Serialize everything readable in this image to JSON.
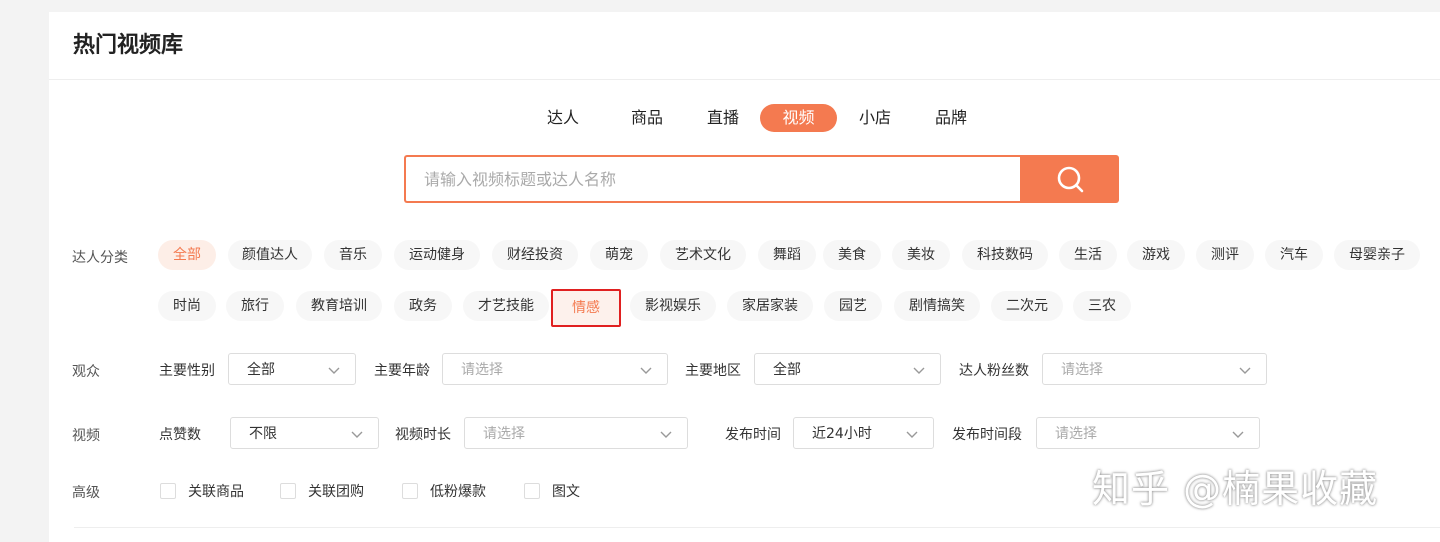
{
  "header": {
    "title": "热门视频库"
  },
  "tabs": [
    {
      "label": "达人",
      "active": false
    },
    {
      "label": "商品",
      "active": false
    },
    {
      "label": "直播",
      "active": false
    },
    {
      "label": "视频",
      "active": true
    },
    {
      "label": "小店",
      "active": false
    },
    {
      "label": "品牌",
      "active": false
    }
  ],
  "search": {
    "placeholder": "请输入视频标题或达人名称",
    "icon": "search-icon"
  },
  "category": {
    "label": "达人分类",
    "row1": [
      "全部",
      "颜值达人",
      "音乐",
      "运动健身",
      "财经投资",
      "萌宠",
      "艺术文化",
      "舞蹈",
      "美食",
      "美妆",
      "科技数码",
      "生活",
      "游戏",
      "测评",
      "汽车",
      "母婴亲子"
    ],
    "row2": [
      "时尚",
      "旅行",
      "教育培训",
      "政务",
      "才艺技能",
      "情感",
      "影视娱乐",
      "家居家装",
      "园艺",
      "剧情搞笑",
      "二次元",
      "三农"
    ],
    "active": "全部",
    "highlighted": "情感"
  },
  "audience": {
    "label": "观众",
    "filters": [
      {
        "label": "主要性别",
        "value": "全部",
        "placeholder": false
      },
      {
        "label": "主要年龄",
        "value": "请选择",
        "placeholder": true
      },
      {
        "label": "主要地区",
        "value": "全部",
        "placeholder": false
      },
      {
        "label": "达人粉丝数",
        "value": "请选择",
        "placeholder": true
      }
    ]
  },
  "video": {
    "label": "视频",
    "filters": [
      {
        "label": "点赞数",
        "value": "不限",
        "placeholder": false
      },
      {
        "label": "视频时长",
        "value": "请选择",
        "placeholder": true
      },
      {
        "label": "发布时间",
        "value": "近24小时",
        "placeholder": false
      },
      {
        "label": "发布时间段",
        "value": "请选择",
        "placeholder": true
      }
    ]
  },
  "advanced": {
    "label": "高级",
    "options": [
      "关联商品",
      "关联团购",
      "低粉爆款",
      "图文"
    ]
  },
  "watermark": "知乎 @楠果收藏",
  "colors": {
    "accent": "#f47a50",
    "highlight_border": "#e02020"
  }
}
